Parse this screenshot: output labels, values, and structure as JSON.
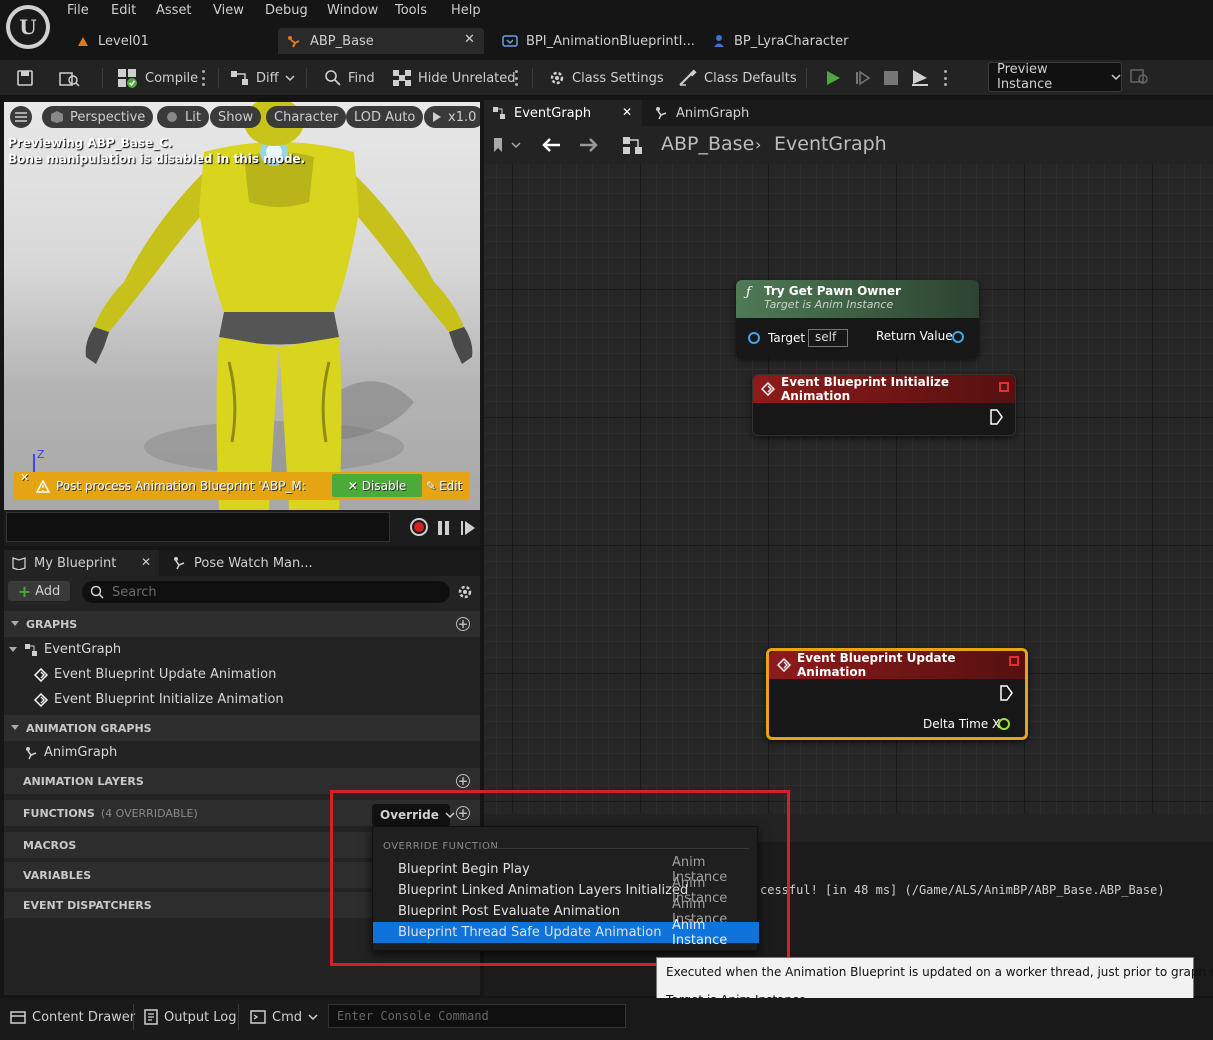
{
  "menu": [
    "File",
    "Edit",
    "Asset",
    "View",
    "Debug",
    "Window",
    "Tools",
    "Help"
  ],
  "doc_tabs": [
    {
      "label": "Level01"
    },
    {
      "label": "ABP_Base",
      "active": true
    },
    {
      "label": "BPI_AnimationBlueprintI..."
    },
    {
      "label": "BP_LyraCharacter"
    }
  ],
  "toolbar": {
    "compile": "Compile",
    "diff": "Diff",
    "find": "Find",
    "hide_unrelated": "Hide Unrelated",
    "class_settings": "Class Settings",
    "class_defaults": "Class Defaults",
    "preview_instance": "Preview Instance"
  },
  "viewport": {
    "perspective": "Perspective",
    "lit": "Lit",
    "show": "Show",
    "character": "Character",
    "lod": "LOD Auto",
    "speed": "x1.0",
    "line1": "Previewing ABP_Base_C.",
    "line2": "Bone manipulation is disabled in this mode.",
    "axis": "Z",
    "warning": "Post process Animation Blueprint 'ABP_M:",
    "disable": "Disable",
    "edit": "Edit"
  },
  "my_blueprint": {
    "tab": "My Blueprint",
    "tab2": "Pose Watch Man...",
    "add": "Add",
    "search_placeholder": "Search",
    "graphs_header": "GRAPHS",
    "eventgraph": "EventGraph",
    "ev_update": "Event Blueprint Update Animation",
    "ev_init": "Event Blueprint Initialize Animation",
    "anim_graphs_header": "ANIMATION GRAPHS",
    "animgraph": "AnimGraph",
    "anim_layers_header": "ANIMATION LAYERS",
    "functions_header": "FUNCTIONS",
    "functions_sub": "(4 OVERRIDABLE)",
    "override": "Override",
    "macros": "MACROS",
    "variables": "VARIABLES",
    "dispatchers": "EVENT DISPATCHERS"
  },
  "graph": {
    "tab1": "EventGraph",
    "tab2": "AnimGraph",
    "crumb1": "ABP_Base",
    "crumb2": "EventGraph",
    "node_pawn_title": "Try Get Pawn Owner",
    "node_pawn_sub": "Target is Anim Instance",
    "node_pawn_target": "Target",
    "node_pawn_self": "self",
    "node_pawn_return": "Return Value",
    "node_init_title": "Event Blueprint Initialize Animation",
    "node_update_title": "Event Blueprint Update Animation",
    "node_update_delta": "Delta Time X"
  },
  "output_log": {
    "line": "cessful! [in 48 ms] (/Game/ALS/AnimBP/ABP_Base.ABP_Base)"
  },
  "override_menu": {
    "header": "OVERRIDE FUNCTION",
    "items": [
      {
        "label": "Blueprint Begin Play",
        "owner": "Anim Instance"
      },
      {
        "label": "Blueprint Linked Animation Layers Initialized",
        "owner": "Anim Instance"
      },
      {
        "label": "Blueprint Post Evaluate Animation",
        "owner": "Anim Instance"
      },
      {
        "label": "Blueprint Thread Safe Update Animation",
        "owner": "Anim Instance"
      }
    ],
    "highlighted_index": 3
  },
  "tooltip": {
    "line1": "Executed when the Animation Blueprint is updated on a worker thread, just prior to graph update",
    "line2": "Target is Anim Instance"
  },
  "statusbar": {
    "content_drawer": "Content Drawer",
    "output_log": "Output Log",
    "cmd": "Cmd",
    "console_placeholder": "Enter Console Command"
  },
  "colors": {
    "accent": "#0e73da",
    "highlight_box": "#d42121",
    "warning": "#e5a512",
    "event_node": "#8a1a1a",
    "function_node": "#3f6b46"
  }
}
